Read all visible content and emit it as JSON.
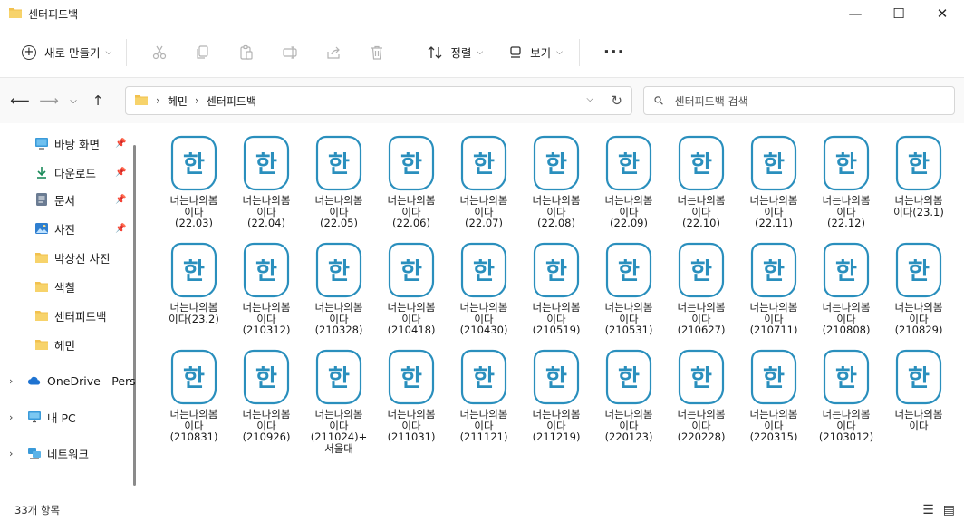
{
  "window": {
    "title": "센터피드백",
    "minimize": "—",
    "maximize": "☐",
    "close": "✕"
  },
  "toolbar": {
    "new_label": "새로 만들기",
    "sort_label": "정렬",
    "view_label": "보기",
    "more_label": "···"
  },
  "address": {
    "crumbs": [
      "헤민",
      "센터피드백"
    ],
    "separator": "›"
  },
  "search": {
    "placeholder": "센터피드백 검색"
  },
  "sidebar": {
    "items": [
      {
        "label": "바탕 화면",
        "icon": "desktop-icon",
        "pinned": true
      },
      {
        "label": "다운로드",
        "icon": "download-icon",
        "pinned": true
      },
      {
        "label": "문서",
        "icon": "documents-icon",
        "pinned": true
      },
      {
        "label": "사진",
        "icon": "pictures-icon",
        "pinned": true
      },
      {
        "label": "박상선 사진",
        "icon": "folder-icon",
        "pinned": false
      },
      {
        "label": "색칠",
        "icon": "folder-icon",
        "pinned": false
      },
      {
        "label": "센터피드백",
        "icon": "folder-icon",
        "pinned": false
      },
      {
        "label": "헤민",
        "icon": "folder-icon",
        "pinned": false
      },
      {
        "label": "OneDrive - Perso",
        "icon": "cloud-icon",
        "pinned": false
      },
      {
        "label": "내 PC",
        "icon": "pc-icon",
        "pinned": false
      },
      {
        "label": "네트워크",
        "icon": "network-icon",
        "pinned": false
      }
    ],
    "pin_glyph": "📌"
  },
  "files": [
    "너는나의봄\n이다\n(22.03)",
    "너는나의봄\n이다\n(22.04)",
    "너는나의봄\n이다\n(22.05)",
    "너는나의봄\n이다\n(22.06)",
    "너는나의봄\n이다\n(22.07)",
    "너는나의봄\n이다\n(22.08)",
    "너는나의봄\n이다\n(22.09)",
    "너는나의봄\n이다\n(22.10)",
    "너는나의봄\n이다\n(22.11)",
    "너는나의봄\n이다\n(22.12)",
    "너는나의봄\n이다(23.1)",
    "너는나의봄\n이다(23.2)",
    "너는나의봄\n이다\n(210312)",
    "너는나의봄\n이다\n(210328)",
    "너는나의봄\n이다\n(210418)",
    "너는나의봄\n이다\n(210430)",
    "너는나의봄\n이다\n(210519)",
    "너는나의봄\n이다\n(210531)",
    "너는나의봄\n이다\n(210627)",
    "너는나의봄\n이다\n(210711)",
    "너는나의봄\n이다\n(210808)",
    "너는나의봄\n이다\n(210829)",
    "너는나의봄\n이다\n(210831)",
    "너는나의봄\n이다\n(210926)",
    "너는나의봄\n이다\n(211024)+\n서울대",
    "너는나의봄\n이다\n(211031)",
    "너는나의봄\n이다\n(211121)",
    "너는나의봄\n이다\n(211219)",
    "너는나의봄\n이다\n(220123)",
    "너는나의봄\n이다\n(220228)",
    "너는나의봄\n이다\n(220315)",
    "너는나의봄\n이다\n(2103012)",
    "너는나의봄\n이다"
  ],
  "file_icon": {
    "name": "hangul-document-icon",
    "glyph": "한",
    "color": "#2a8fbd"
  },
  "status": {
    "item_count": "33개 항목"
  },
  "colors": {
    "folder": "#f2c14e",
    "accent": "#2a8fbd"
  }
}
